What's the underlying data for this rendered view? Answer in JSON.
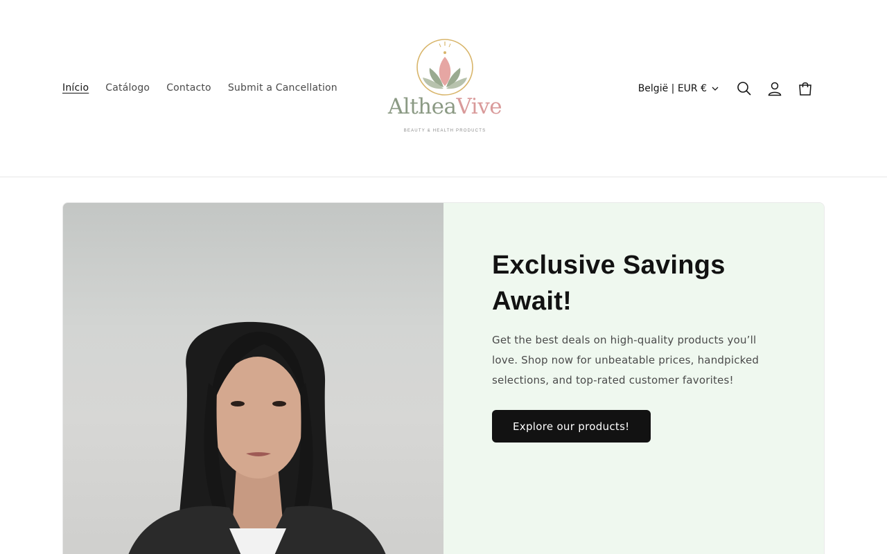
{
  "nav": {
    "items": [
      {
        "label": "Início",
        "active": true
      },
      {
        "label": "Catálogo",
        "active": false
      },
      {
        "label": "Contacto",
        "active": false
      },
      {
        "label": "Submit a Cancellation",
        "active": false
      }
    ]
  },
  "logo": {
    "name_part1": "Althea",
    "name_part2": "Vive",
    "tagline": "BEAUTY & HEALTH PRODUCTS"
  },
  "utils": {
    "locale": "België | EUR €",
    "icons": [
      "search-icon",
      "account-icon",
      "cart-icon"
    ]
  },
  "hero": {
    "heading": "Exclusive Savings Await!",
    "text": "Get the best deals on high-quality products you’ll love. Shop now for unbeatable prices, handpicked selections, and top-rated customer favorites!",
    "button_label": "Explore our products!"
  },
  "colors": {
    "accent_green": "#8b9a84",
    "accent_pink": "#d99a9a",
    "hero_bg": "#eff8ef",
    "button_bg": "#121212"
  }
}
